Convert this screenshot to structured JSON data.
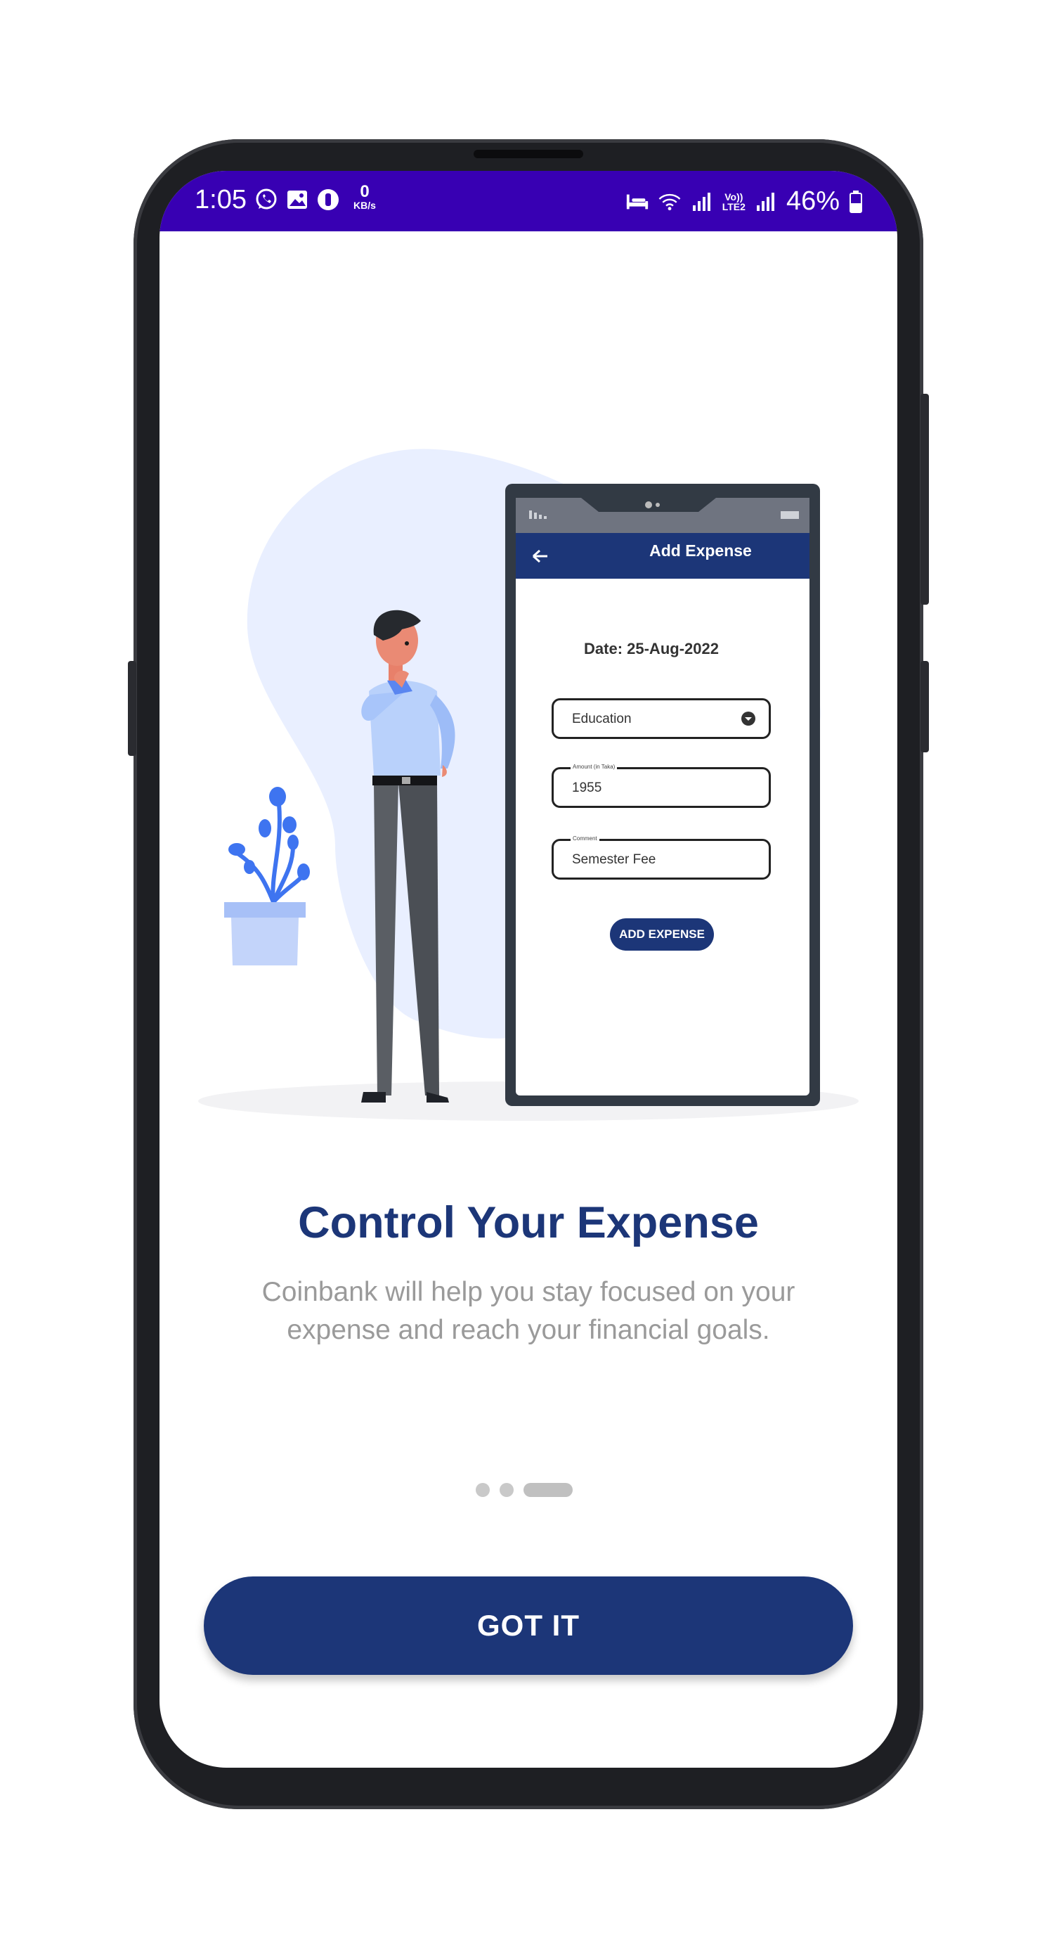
{
  "status_bar": {
    "time": "1:05",
    "network_speed_value": "0",
    "network_speed_unit": "KB/s",
    "volte_top": "Vo))",
    "volte_bottom": "LTE2",
    "battery": "46%"
  },
  "illustration": {
    "mock_title": "Add Expense",
    "mock_date": "Date: 25-Aug-2022",
    "category": "Education",
    "amount_label": "Amount (in Taka)",
    "amount_value": "1955",
    "comment_label": "Comment",
    "comment_value": "Semester Fee",
    "mock_button": "ADD EXPENSE"
  },
  "onboarding": {
    "title": "Control Your Expense",
    "subtitle": "Coinbank will help you stay focused on your expense and reach your financial goals.",
    "page_count": 3,
    "active_page": 3,
    "button_label": "GOT IT"
  },
  "colors": {
    "status_bar": "#3800b3",
    "primary": "#1c3678",
    "accent_blue": "#4a7cf0"
  }
}
